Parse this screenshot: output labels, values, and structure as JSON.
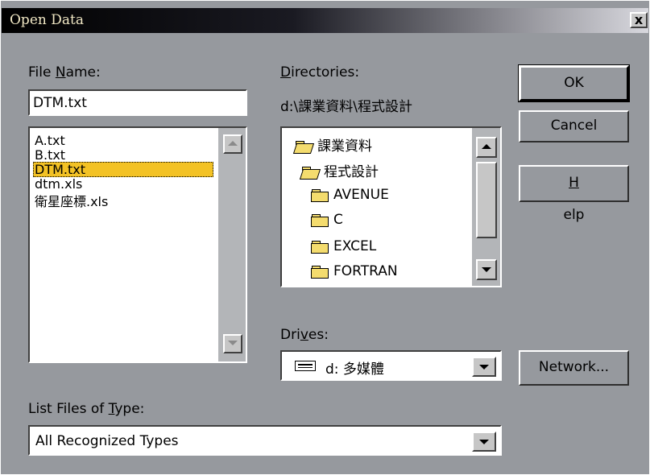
{
  "window": {
    "title": "Open Data",
    "close_glyph": "x"
  },
  "file_name": {
    "label_pre": "File ",
    "label_key": "N",
    "label_post": "ame:",
    "value": "DTM.txt",
    "files": [
      "A.txt",
      "B.txt",
      "DTM.txt",
      "dtm.xls",
      "衛星座標.xls"
    ],
    "selected_index": 2
  },
  "directories": {
    "label_key": "D",
    "label_post": "irectories:",
    "current_path": "d:\\課業資料\\程式設計",
    "items": [
      {
        "name": "課業資料",
        "icon": "open-folder-icon"
      },
      {
        "name": "程式設計",
        "icon": "open-folder-icon"
      },
      {
        "name": "AVENUE",
        "icon": "folder-icon"
      },
      {
        "name": "C",
        "icon": "folder-icon"
      },
      {
        "name": "EXCEL",
        "icon": "folder-icon"
      },
      {
        "name": "FORTRAN",
        "icon": "folder-icon"
      }
    ]
  },
  "drives": {
    "label_pre": "Dri",
    "label_key": "v",
    "label_post": "es:",
    "value": "d: 多媒體",
    "icon": "drive-icon"
  },
  "file_type": {
    "label_pre": "List Files of ",
    "label_key": "T",
    "label_post": "ype:",
    "value": "All Recognized Types"
  },
  "buttons": {
    "ok": "OK",
    "cancel": "Cancel",
    "help_key": "H",
    "help_post": "elp",
    "network": "Network..."
  },
  "colors": {
    "dialog_bg": "#96999e",
    "selection": "#f3c225",
    "folder": "#f4dc6e"
  }
}
